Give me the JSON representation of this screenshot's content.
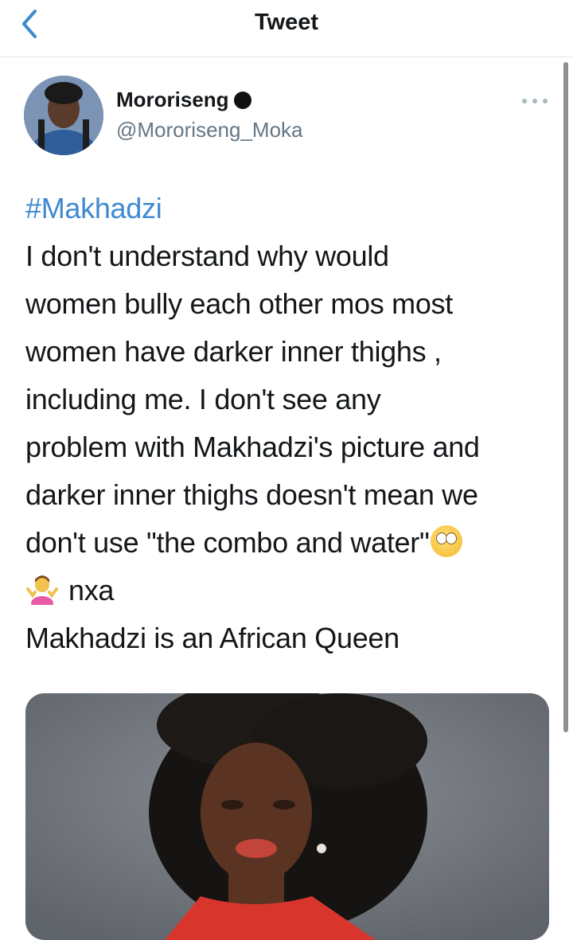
{
  "nav": {
    "title": "Tweet",
    "back_icon": "chevron-left-icon"
  },
  "tweet": {
    "author": {
      "display_name": "Mororiseng",
      "handle": "@Mororiseng_Moka"
    },
    "hashtag": "#Makhadzi",
    "lines": [
      "I don't understand why would",
      "women bully each other   mos most",
      "women have darker inner thighs ,",
      "including me. I don't see any",
      "problem with Makhadzi's picture and",
      "darker inner thighs doesn't mean we",
      "don't use \"the  combo and water\""
    ],
    "line_nxa": "nxa",
    "line_last": "Makhadzi is an African Queen"
  },
  "colors": {
    "accent": "#3e89d0",
    "text": "#14171a",
    "secondary": "#657786",
    "divider": "#e1e8ed"
  }
}
